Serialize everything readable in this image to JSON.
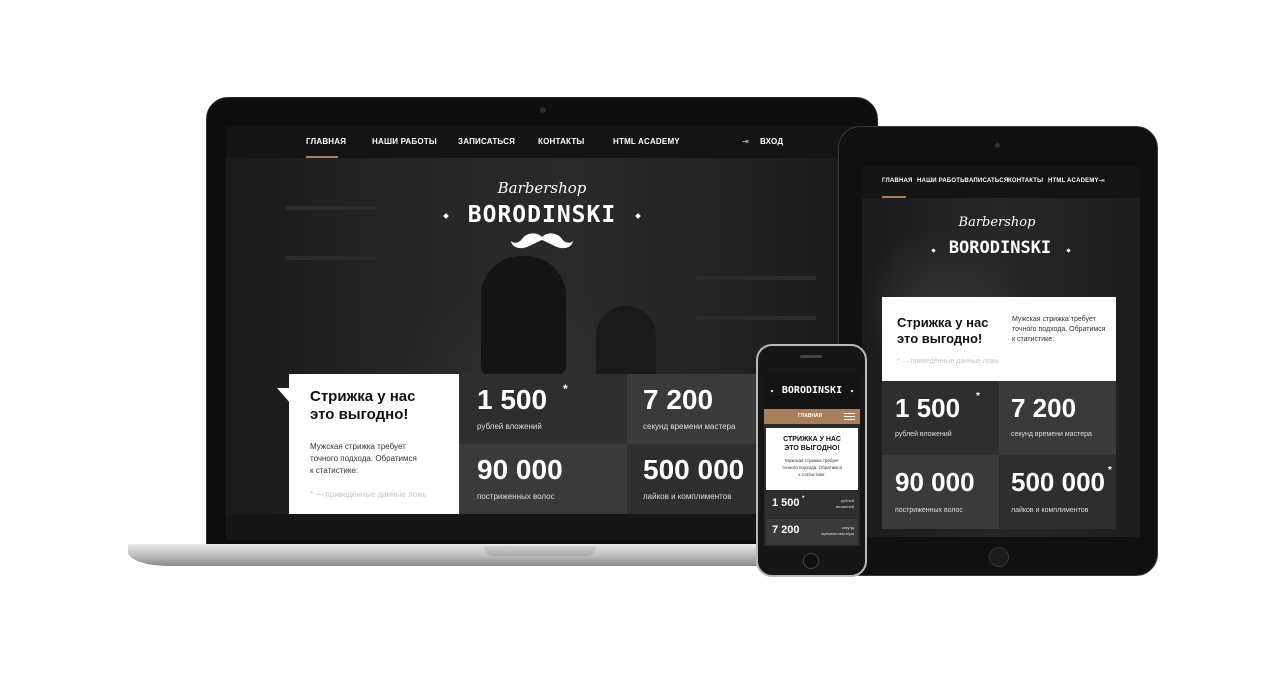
{
  "site": {
    "nav": {
      "home": "ГЛАВНАЯ",
      "works": "НАШИ РАБОТЫ",
      "signup": "ЗАПИСАТЬСЯ",
      "contacts": "КОНТАКТЫ",
      "academy": "HTML ACADEMY",
      "login": "ВХОД"
    },
    "logo": {
      "script": "Barbershop",
      "name": "BORODINSKI"
    },
    "promo": {
      "title_line1": "Стрижка у нас",
      "title_line2": "это выгодно!",
      "text_line1": "Мужская стрижка требует",
      "text_line2": "точного подхода. Обратимся",
      "text_line3": "к статистике:",
      "note": "* — приведённые данные ложь"
    },
    "stats": [
      {
        "value": "1 500",
        "star": "*",
        "label": "рублей вложений"
      },
      {
        "value": "7 200",
        "star": "",
        "label": "секунд времени мастера"
      },
      {
        "value": "90 000",
        "star": "",
        "label": "постриженных волос"
      },
      {
        "value": "500 000",
        "star": "*",
        "label": "лайков и комплиментов"
      }
    ]
  },
  "tablet": {
    "promo": {
      "text_line1": "Мужская стрижка требует",
      "text_line2": "точного подхода. Обратимся",
      "text_line3": "к статистике:"
    }
  },
  "phone": {
    "logo": "BORODINSKI",
    "nav_label": "ГЛАВНАЯ",
    "promo": {
      "title_line1": "СТРИЖКА У НАС",
      "title_line2": "ЭТО ВЫГОДНО!",
      "text_line1": "Мужская стрижка требует",
      "text_line2": "точного подхода. Обратимся",
      "text_line3": "к статистике:"
    },
    "stats": [
      {
        "value": "1 500",
        "star": "*",
        "label_line1": "рублей",
        "label_line2": "вложений"
      },
      {
        "value": "7 200",
        "star": "",
        "label_line1": "секунд",
        "label_line2": "времени мастера"
      }
    ]
  },
  "colors": {
    "accent": "#a97e5b",
    "stat_dark": "#2e2e2e",
    "stat_mid": "#3a3a3a",
    "nav_bg": "#141414"
  }
}
